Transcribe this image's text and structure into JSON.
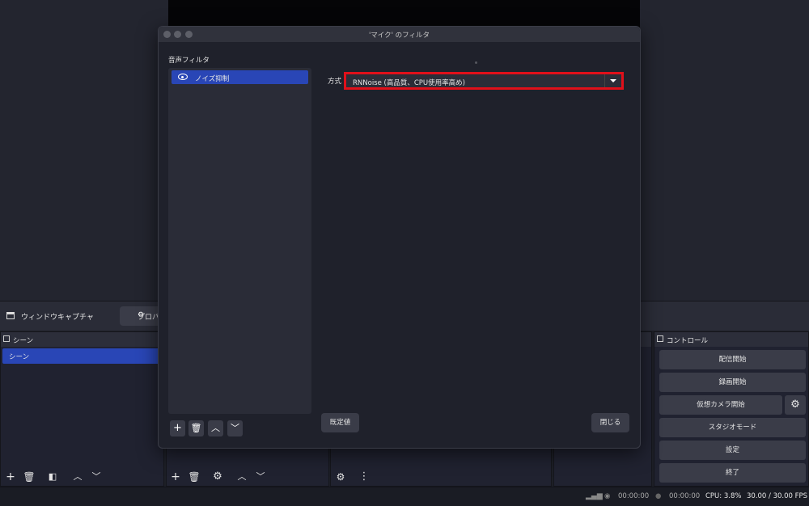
{
  "app": {
    "source_name": "ウィンドウキャプチャ",
    "properties_label": "プロパ",
    "scenes": {
      "title": "シーン",
      "items": [
        "シーン"
      ]
    },
    "controls": {
      "title": "コントロール",
      "buttons": [
        "配信開始",
        "録画開始",
        "仮想カメラ開始",
        "スタジオモード",
        "設定",
        "終了"
      ]
    },
    "status": {
      "rec_time": "00:00:00",
      "stream_time": "00:00:00",
      "cpu": "CPU: 3.8%",
      "fps": "30.00 / 30.00 FPS"
    }
  },
  "dialog": {
    "title": "'マイク' のフィルタ",
    "filters_label": "音声フィルタ",
    "filters": [
      "ノイズ抑制"
    ],
    "method_label": "方式",
    "method_value": "RNNoise (高品質、CPU使用率高め)",
    "defaults_button": "既定値",
    "close_button": "閉じる"
  },
  "colors": {
    "accent": "#2946b6",
    "highlight": "#e0101a"
  }
}
